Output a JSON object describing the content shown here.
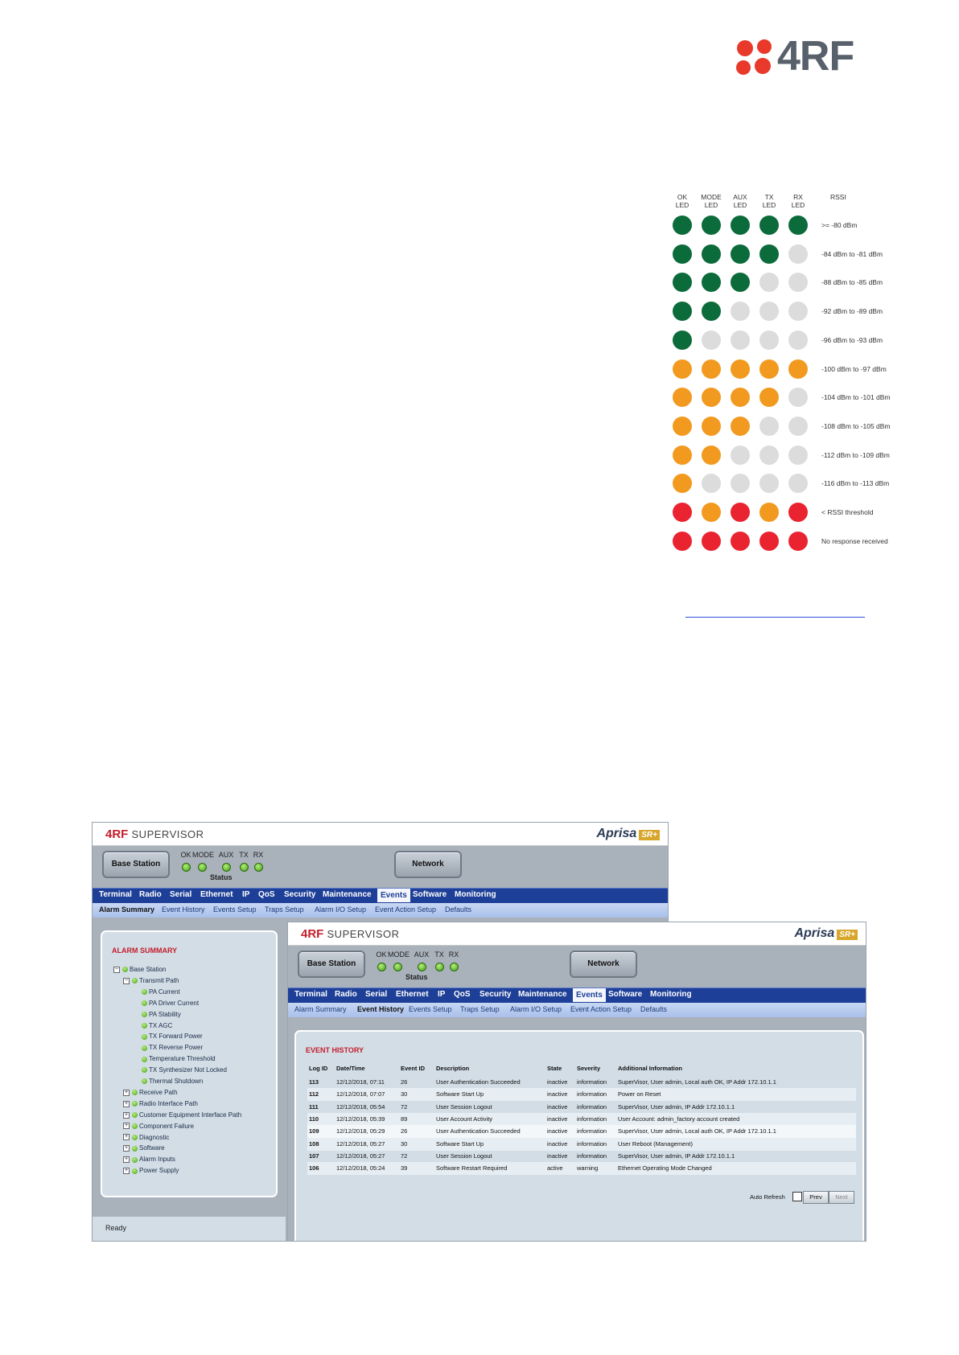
{
  "logo": {
    "text": "4RF",
    "brand_color": "#e8392a"
  },
  "led_chart": {
    "headers": [
      [
        "OK",
        "LED"
      ],
      [
        "MODE",
        "LED"
      ],
      [
        "AUX",
        "LED"
      ],
      [
        "TX",
        "LED"
      ],
      [
        "RX",
        "LED"
      ],
      [
        "RSSI",
        ""
      ]
    ],
    "colors": {
      "green": "#0b6b3a",
      "orange": "#f29a1f",
      "red": "#ea2330",
      "off": "#dcdcdc"
    },
    "rows": [
      {
        "leds": [
          "green",
          "green",
          "green",
          "green",
          "green"
        ],
        "label": ">= -80 dBm"
      },
      {
        "leds": [
          "green",
          "green",
          "green",
          "green",
          "off"
        ],
        "label": "-84 dBm to -81 dBm"
      },
      {
        "leds": [
          "green",
          "green",
          "green",
          "off",
          "off"
        ],
        "label": "-88 dBm to -85 dBm"
      },
      {
        "leds": [
          "green",
          "green",
          "off",
          "off",
          "off"
        ],
        "label": "-92 dBm to -89 dBm"
      },
      {
        "leds": [
          "green",
          "off",
          "off",
          "off",
          "off"
        ],
        "label": "-96 dBm to -93 dBm"
      },
      {
        "leds": [
          "orange",
          "orange",
          "orange",
          "orange",
          "orange"
        ],
        "label": "-100 dBm to -97 dBm"
      },
      {
        "leds": [
          "orange",
          "orange",
          "orange",
          "orange",
          "off"
        ],
        "label": "-104 dBm to -101 dBm"
      },
      {
        "leds": [
          "orange",
          "orange",
          "orange",
          "off",
          "off"
        ],
        "label": "-108 dBm to -105 dBm"
      },
      {
        "leds": [
          "orange",
          "orange",
          "off",
          "off",
          "off"
        ],
        "label": "-112 dBm to -109 dBm"
      },
      {
        "leds": [
          "orange",
          "off",
          "off",
          "off",
          "off"
        ],
        "label": "-116 dBm to -113 dBm"
      },
      {
        "leds": [
          "red",
          "orange",
          "red",
          "orange",
          "red"
        ],
        "label": "< RSSI threshold"
      },
      {
        "leds": [
          "red",
          "red",
          "red",
          "red",
          "red"
        ],
        "label": "No response received"
      }
    ]
  },
  "supervisor": {
    "logo_brand": "4RF",
    "logo_product": "SUPERVISOR",
    "aprisa": "Aprisa",
    "aprisa_badge": "SR+",
    "base_station_button": "Base Station",
    "network_button": "Network",
    "status_leds": [
      "OK",
      "MODE",
      "AUX",
      "TX",
      "RX"
    ],
    "status_label": "Status",
    "menu": [
      "Terminal",
      "Radio",
      "Serial",
      "Ethernet",
      "IP",
      "QoS",
      "Security",
      "Maintenance",
      "Events",
      "Software",
      "Monitoring"
    ],
    "submenu": [
      "Alarm Summary",
      "Event History",
      "Events Setup",
      "Traps Setup",
      "Alarm I/O Setup",
      "Event Action Setup",
      "Defaults"
    ]
  },
  "alarm_summary": {
    "title": "ALARM SUMMARY",
    "tree": [
      {
        "label": "Base Station",
        "level": 0,
        "toggle": "−"
      },
      {
        "label": "Transmit Path",
        "level": 1,
        "toggle": "−"
      },
      {
        "label": "PA Current",
        "level": 2,
        "toggle": ""
      },
      {
        "label": "PA Driver Current",
        "level": 2,
        "toggle": ""
      },
      {
        "label": "PA Stability",
        "level": 2,
        "toggle": ""
      },
      {
        "label": "TX AGC",
        "level": 2,
        "toggle": ""
      },
      {
        "label": "TX Forward Power",
        "level": 2,
        "toggle": ""
      },
      {
        "label": "TX Reverse Power",
        "level": 2,
        "toggle": ""
      },
      {
        "label": "Temperature Threshold",
        "level": 2,
        "toggle": ""
      },
      {
        "label": "TX Synthesizer Not Locked",
        "level": 2,
        "toggle": ""
      },
      {
        "label": "Thermal Shutdown",
        "level": 2,
        "toggle": ""
      },
      {
        "label": "Receive Path",
        "level": 1,
        "toggle": "+"
      },
      {
        "label": "Radio Interface Path",
        "level": 1,
        "toggle": "+"
      },
      {
        "label": "Customer Equipment Interface Path",
        "level": 1,
        "toggle": "+"
      },
      {
        "label": "Component Failure",
        "level": 1,
        "toggle": "+"
      },
      {
        "label": "Diagnostic",
        "level": 1,
        "toggle": "+"
      },
      {
        "label": "Software",
        "level": 1,
        "toggle": "+"
      },
      {
        "label": "Alarm Inputs",
        "level": 1,
        "toggle": "+"
      },
      {
        "label": "Power Supply",
        "level": 1,
        "toggle": "+"
      }
    ],
    "status_text": "Ready"
  },
  "event_history": {
    "title": "EVENT HISTORY",
    "columns": [
      "Log ID",
      "Date/Time",
      "Event ID",
      "Description",
      "State",
      "Severity",
      "Additional Information"
    ],
    "rows": [
      [
        "113",
        "12/12/2018, 07:11",
        "26",
        "User Authentication Succeeded",
        "inactive",
        "information",
        "SuperVisor, User admin, Local auth OK, IP Addr 172.10.1.1"
      ],
      [
        "112",
        "12/12/2018, 07:07",
        "30",
        "Software Start Up",
        "inactive",
        "information",
        "Power on Reset"
      ],
      [
        "111",
        "12/12/2018, 05:54",
        "72",
        "User Session Logout",
        "inactive",
        "information",
        "SuperVisor, User admin, IP Addr 172.10.1.1"
      ],
      [
        "110",
        "12/12/2018, 05:39",
        "89",
        "User Account Activity",
        "inactive",
        "information",
        "User Account: admin_factory account created"
      ],
      [
        "109",
        "12/12/2018, 05:29",
        "26",
        "User Authentication Succeeded",
        "inactive",
        "information",
        "SuperVisor, User admin, Local auth OK, IP Addr 172.10.1.1"
      ],
      [
        "108",
        "12/12/2018, 05:27",
        "30",
        "Software Start Up",
        "inactive",
        "information",
        "User Reboot (Management)"
      ],
      [
        "107",
        "12/12/2018, 05:27",
        "72",
        "User Session Logout",
        "inactive",
        "information",
        "SuperVisor, User admin, IP Addr 172.10.1.1"
      ],
      [
        "106",
        "12/12/2018, 05:24",
        "39",
        "Software Restart Required",
        "active",
        "warning",
        "Ethernet Operating Mode Changed"
      ]
    ],
    "auto_refresh_label": "Auto Refresh",
    "prev_label": "Prev",
    "next_label": "Next"
  }
}
